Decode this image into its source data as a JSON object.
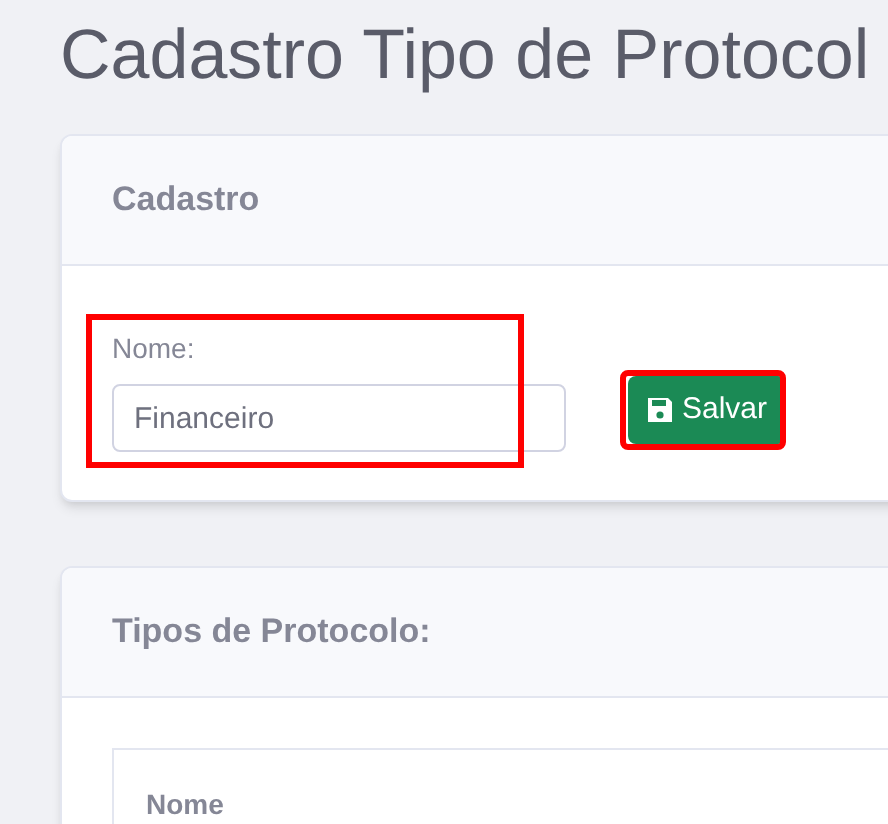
{
  "page_title": "Cadastro Tipo de Protocol",
  "form_card": {
    "title": "Cadastro",
    "field": {
      "label": "Nome:",
      "value": "Financeiro"
    },
    "save_button": "Salvar"
  },
  "list_card": {
    "title": "Tipos de Protocolo:",
    "table": {
      "columns": [
        "Nome"
      ]
    }
  }
}
